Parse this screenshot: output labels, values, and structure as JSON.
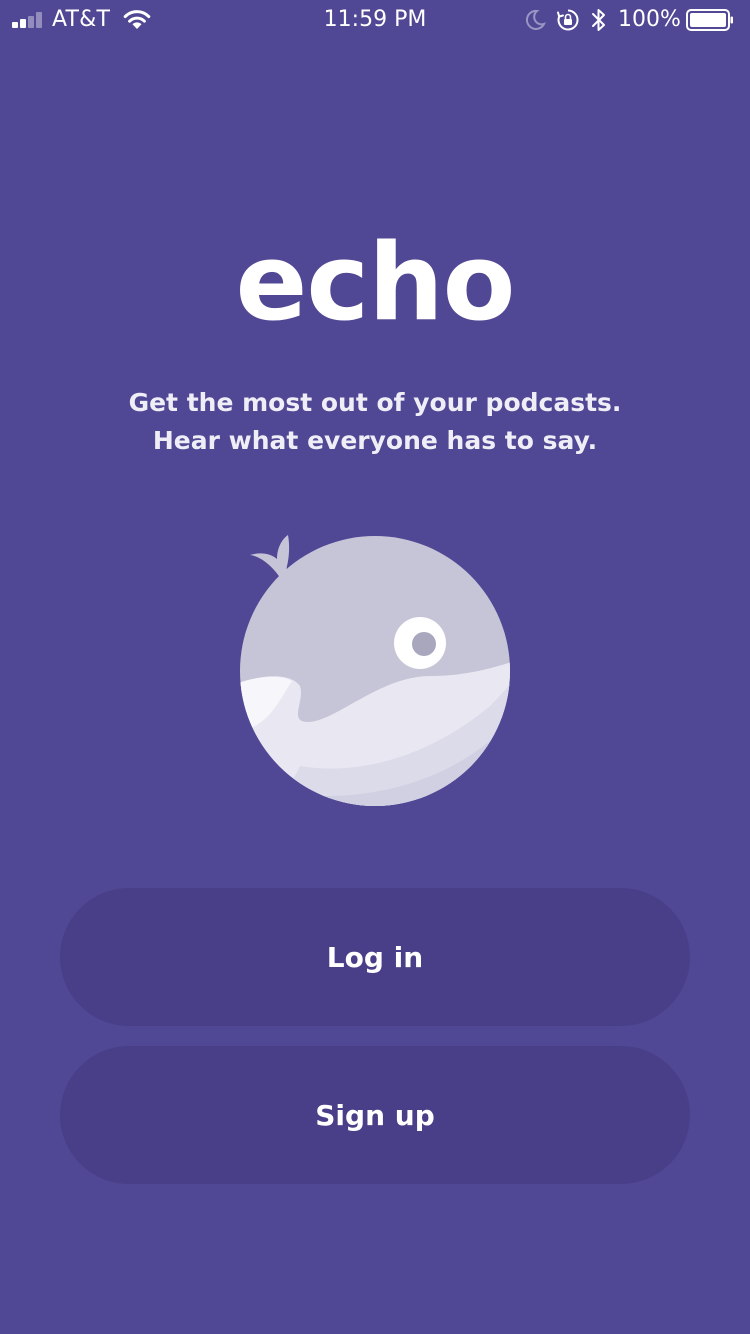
{
  "status_bar": {
    "carrier": "AT&T",
    "time": "11:59 PM",
    "battery_percent": "100%",
    "signal_bars": 2,
    "icons": [
      "signal-icon",
      "wifi-icon",
      "moon-icon",
      "rotation-lock-icon",
      "bluetooth-icon",
      "battery-icon"
    ]
  },
  "app": {
    "logo_text": "echo",
    "tagline_line1": "Get the most out of your podcasts.",
    "tagline_line2": "Hear what everyone has to say.",
    "illustration": "whale-icon"
  },
  "actions": {
    "login_label": "Log in",
    "signup_label": "Sign up"
  },
  "colors": {
    "background": "#504895",
    "button": "#483f88",
    "text": "#ffffff",
    "whale_body": "#c6c5d8",
    "whale_belly": "#e9e8f2"
  }
}
